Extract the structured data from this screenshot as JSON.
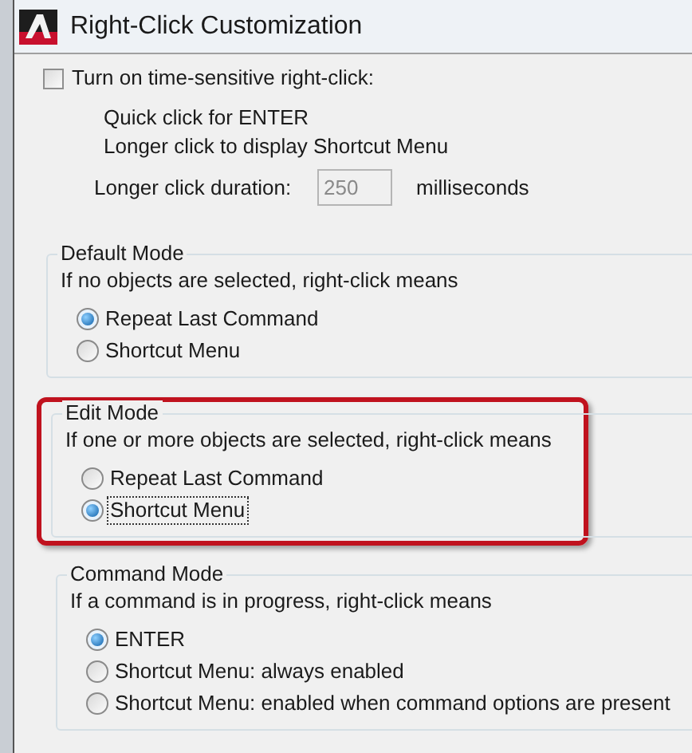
{
  "window": {
    "title": "Right-Click Customization"
  },
  "time_sensitive": {
    "label": "Turn on time-sensitive right-click:",
    "checked": false,
    "lines": [
      "Quick click for ENTER",
      "Longer click to display Shortcut Menu"
    ],
    "duration": {
      "label": "Longer click duration:",
      "value": "250",
      "disabled": true,
      "unit": "milliseconds"
    }
  },
  "groups": [
    {
      "title": "Default Mode",
      "description": "If no objects are selected, right-click means",
      "highlighted": false,
      "options": [
        {
          "label": "Repeat Last Command",
          "selected": true,
          "focused": false
        },
        {
          "label": "Shortcut Menu",
          "selected": false,
          "focused": false
        }
      ]
    },
    {
      "title": "Edit Mode",
      "description": "If one or more objects are selected, right-click means",
      "highlighted": true,
      "options": [
        {
          "label": "Repeat Last Command",
          "selected": false,
          "focused": false
        },
        {
          "label": "Shortcut Menu",
          "selected": true,
          "focused": true
        }
      ]
    },
    {
      "title": "Command Mode",
      "description": "If a command is in progress, right-click means",
      "highlighted": false,
      "options": [
        {
          "label": "ENTER",
          "selected": true,
          "focused": false
        },
        {
          "label": "Shortcut Menu: always enabled",
          "selected": false,
          "focused": false
        },
        {
          "label": "Shortcut Menu: enabled when command options are present",
          "selected": false,
          "focused": false
        }
      ]
    }
  ]
}
